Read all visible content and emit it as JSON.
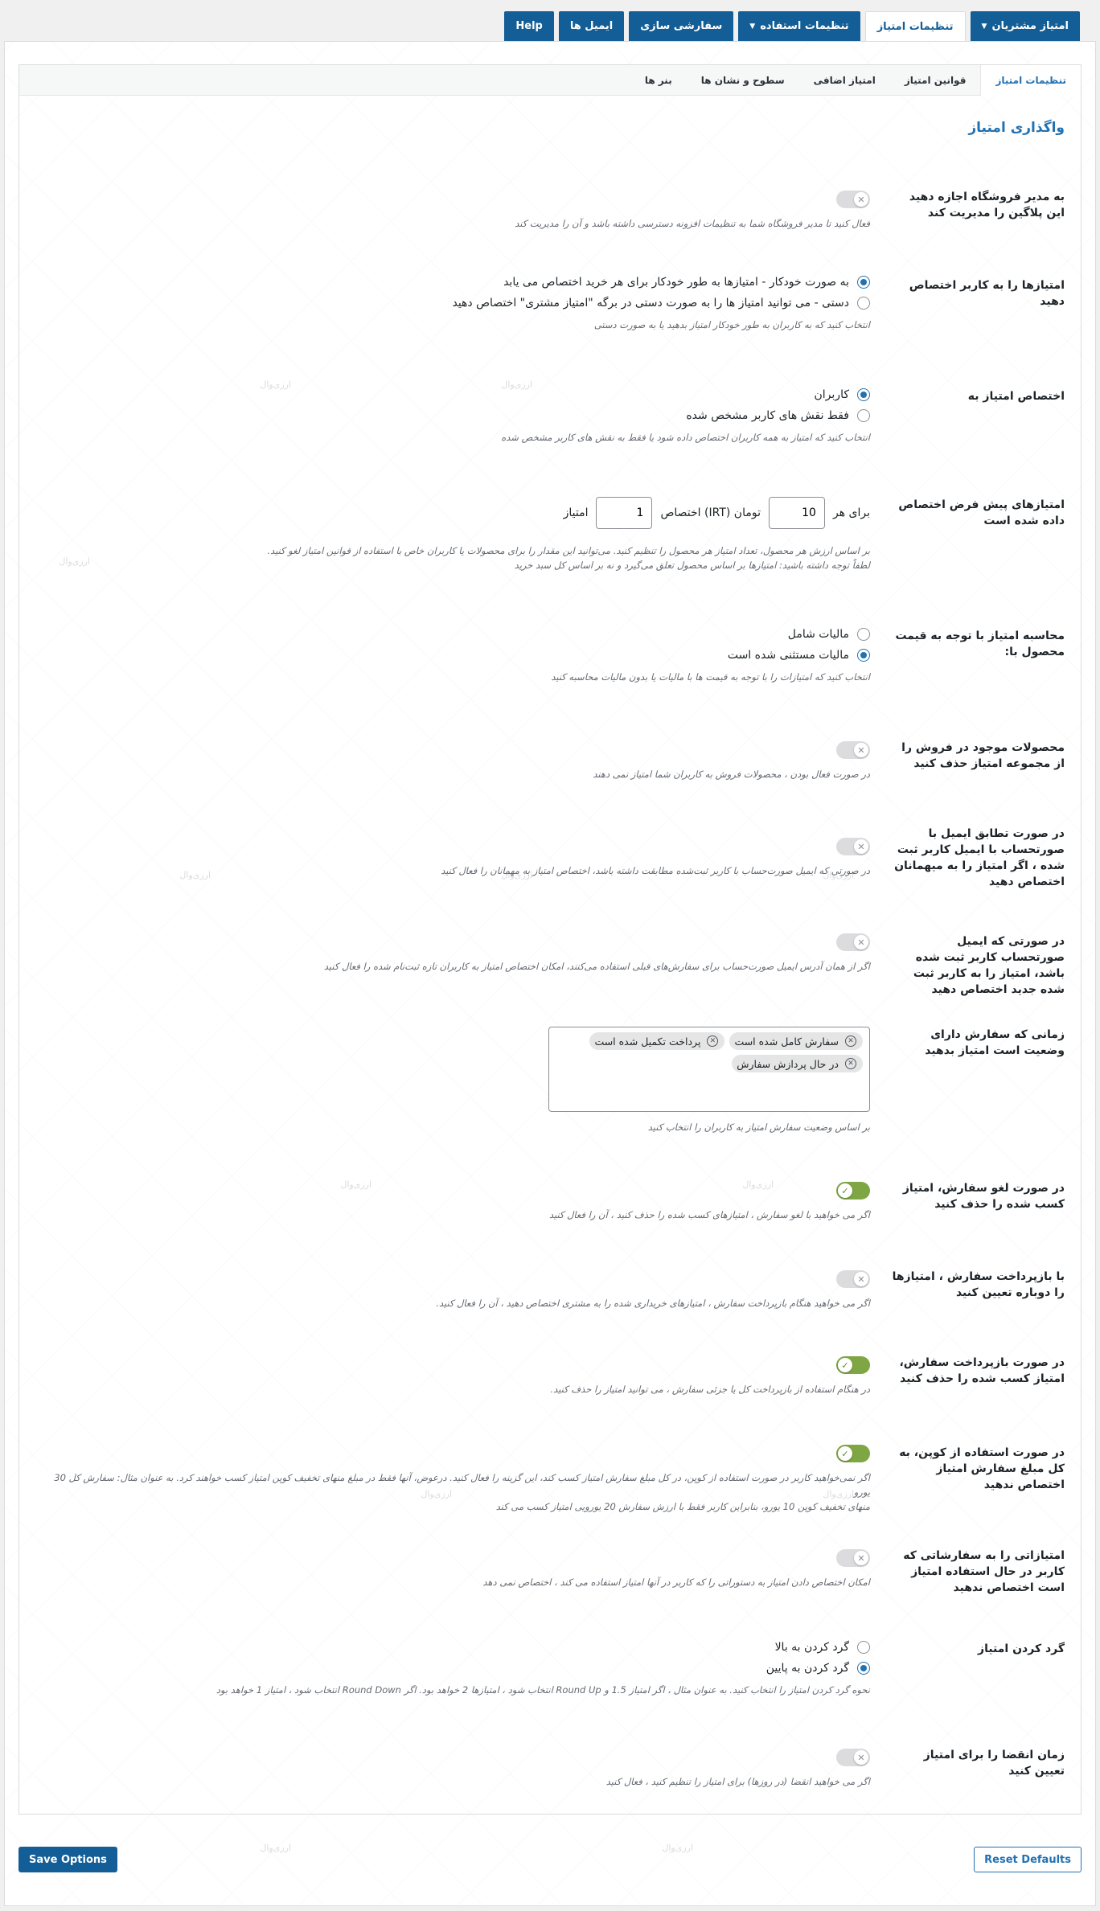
{
  "top_tabs": [
    {
      "label": "امتیاز مشتریان",
      "has_caret": true,
      "active": false
    },
    {
      "label": "تنظیمات امتیاز",
      "has_caret": false,
      "active": true
    },
    {
      "label": "تنظیمات استفاده",
      "has_caret": true,
      "active": false
    },
    {
      "label": "سفارشی سازی",
      "has_caret": false,
      "active": false
    },
    {
      "label": "ایمیل ها",
      "has_caret": false,
      "active": false
    },
    {
      "label": "Help",
      "has_caret": false,
      "active": false
    }
  ],
  "sub_tabs": [
    {
      "label": "تنظیمات امتیاز",
      "active": true
    },
    {
      "label": "قوانین امتیاز",
      "active": false
    },
    {
      "label": "امتیاز اضافی",
      "active": false
    },
    {
      "label": "سطوح و نشان ها",
      "active": false
    },
    {
      "label": "بنر ها",
      "active": false
    }
  ],
  "watermark_text": "ارزی‌وال",
  "section_title": "واگذاری امتیاز",
  "settings": {
    "shop_manager": {
      "label": "به مدیر فروشگاه اجازه دهید این پلاگین را مدیریت کند",
      "enabled": false,
      "desc": "فعال کنید تا مدیر فروشگاه شما به تنظیمات افزونه دسترسی داشته باشد و آن را مدیریت کند"
    },
    "assign_mode": {
      "label": "امتیازها را به کاربر اختصاص دهید",
      "options": [
        {
          "label": "به صورت خودکار - امتیازها به طور خودکار برای هر خرید اختصاص می یابد",
          "checked": true
        },
        {
          "label": "دستی - می توانید امتیاز ها را به صورت دستی در برگه \"امتیاز مشتری\" اختصاص دهید",
          "checked": false
        }
      ],
      "desc": "انتخاب کنید که به کاربران به طور خودکار امتیاز بدهید یا به صورت دستی"
    },
    "assign_to": {
      "label": "اختصاص امتیاز به",
      "options": [
        {
          "label": "کاربران",
          "checked": true
        },
        {
          "label": "فقط نقش های کاربر مشخص شده",
          "checked": false
        }
      ],
      "desc": "انتخاب کنید که امتیاز به همه کاربران اختصاص داده شود یا فقط به نقش های کاربر مشخص شده"
    },
    "default_points": {
      "label": "امتیازهای پیش فرض اختصاص داده شده است",
      "prefix": "برای هر",
      "amount": "10",
      "currency_text": "تومان (IRT) اختصاص",
      "points": "1",
      "suffix": "امتیاز",
      "desc1": "بر اساس ارزش هر محصول، تعداد امتیاز هر محصول را تنظیم کنید. می‌توانید این مقدار را برای محصولات یا کاربران خاص با استفاده از قوانین امتیاز لغو کنید.",
      "desc2": "لطفاً توجه داشته باشید: امتیازها بر اساس محصول تعلق می‌گیرد و نه بر اساس کل سبد خرید"
    },
    "tax_calc": {
      "label": "محاسبه امتیاز با توجه به قیمت محصول با:",
      "options": [
        {
          "label": "مالیات شامل",
          "checked": false
        },
        {
          "label": "مالیات مستثنی شده است",
          "checked": true
        }
      ],
      "desc": "انتخاب کنید که امتیازات را با توجه به قیمت ها با مالیات یا بدون مالیات محاسبه کنید"
    },
    "exclude_sale": {
      "label": "محصولات موجود در فروش را از مجموعه امتیاز حذف کنید",
      "enabled": false,
      "desc": "در صورت فعال بودن ، محصولات فروش به کاربران شما امتیاز نمی دهند"
    },
    "guest_email": {
      "label": "در صورت تطابق ایمیل با صورتحساب با ایمیل کاربر ثبت شده ، اگر امتیاز را به میهمانان اختصاص دهید",
      "enabled": false,
      "desc": "در صورتی که ایمیل صورت‌حساب با کاربر ثبت‌شده مطابقت داشته باشد، اختصاص امتیاز به مهمانان را فعال کنید"
    },
    "new_user_email": {
      "label": "در صورتی که ایمیل صورتحساب کاربر ثبت شده باشد، امتیاز را به کاربر ثبت شده جدید اختصاص دهید",
      "enabled": false,
      "desc": "اگر از همان آدرس ایمیل صورت‌حساب برای سفارش‌های قبلی استفاده می‌کنند، امکان اختصاص امتیاز به کاربران تازه ثبت‌نام شده را فعال کنید"
    },
    "order_status": {
      "label": "زمانی که سفارش دارای وضعیت است امتیاز بدهید",
      "chips": [
        "سفارش کامل شده است",
        "پرداخت تکمیل شده است",
        "در حال پردازش سفارش"
      ],
      "desc": "بر اساس وضعیت سفارش امتیاز به کاربران را انتخاب کنید"
    },
    "remove_on_cancel": {
      "label": "در صورت لغو سفارش، امتیاز کسب شده را حذف کنید",
      "enabled": true,
      "desc": "اگر می خواهید با لغو سفارش ، امتیازهای کسب شده را حذف کنید ، آن را فعال کنید"
    },
    "reassign_on_refund": {
      "label": "با بازپرداخت سفارش ، امتیازها را دوباره تعیین کنید",
      "enabled": false,
      "desc": "اگر می خواهید هنگام بازپرداخت سفارش ، امتیازهای خریداری شده را به مشتری اختصاص دهید ، آن را فعال کنید."
    },
    "remove_on_refund": {
      "label": "در صورت بازپرداخت سفارش، امتیاز کسب شده را حذف کنید",
      "enabled": true,
      "desc": "در هنگام استفاده از بازپرداخت کل یا جزئی سفارش ، می توانید امتیاز را حذف کنید."
    },
    "coupon": {
      "label": "در صورت استفاده از کوپن، به کل مبلغ سفارش امتیاز اختصاص ندهید",
      "enabled": true,
      "desc1": "اگر نمی‌خواهید کاربر در صورت استفاده از کوپن، در کل مبلغ سفارش امتیاز کسب کند، این گزینه را فعال کنید. درعوض، آنها فقط در مبلغ منهای تخفیف کوپن امتیاز کسب خواهند کرد. به عنوان مثال: سفارش کل 30 یورو",
      "desc2": "منهای تخفیف کوپن 10 یورو، بنابراین کاربر فقط با ارزش سفارش 20 یورویی امتیاز کسب می کند"
    },
    "redeeming_orders": {
      "label": "امتیازاتی را به سفارشاتی که کاربر در حال استفاده امتیاز است اختصاص ندهید",
      "enabled": false,
      "desc": "امکان اختصاص دادن امتیاز به دستوراتی را که کاربر در آنها امتیاز استفاده می کند ، اختصاص نمی دهد"
    },
    "rounding": {
      "label": "گرد کردن امتیاز",
      "options": [
        {
          "label": "گرد کردن به بالا",
          "checked": false
        },
        {
          "label": "گرد کردن به پایین",
          "checked": true
        }
      ],
      "desc": "نحوه گرد کردن امتیاز را انتخاب کنید. به عنوان مثال ، اگر امتیاز 1.5 و Round Up انتخاب شود ، امتیازها 2 خواهد بود. اگر Round Down انتخاب شود ، امتیاز 1 خواهد بود"
    },
    "expiration": {
      "label": "زمان انقضا را برای امتیاز تعیین کنید",
      "enabled": false,
      "desc": "اگر می خواهید انقضا (در روزها) برای امتیاز را تنظیم کنید ، فعال کنید"
    }
  },
  "buttons": {
    "save": "Save Options",
    "reset": "Reset Defaults"
  },
  "colors": {
    "accent": "#135e96",
    "toggle_on": "#7ea643",
    "link": "#2271b1"
  }
}
